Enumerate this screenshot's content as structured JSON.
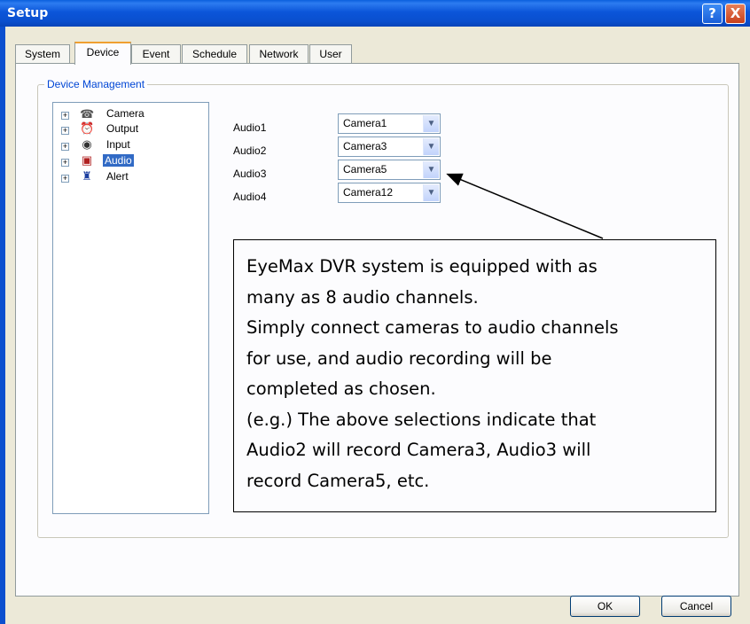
{
  "window": {
    "title": "Setup",
    "help_label": "?",
    "close_label": "X"
  },
  "tabs": [
    {
      "label": "System"
    },
    {
      "label": "Device",
      "active": true
    },
    {
      "label": "Event"
    },
    {
      "label": "Schedule"
    },
    {
      "label": "Network"
    },
    {
      "label": "User"
    }
  ],
  "group": {
    "label": "Device Management"
  },
  "tree": [
    {
      "label": "Camera",
      "icon": "camera-icon"
    },
    {
      "label": "Output",
      "icon": "alarm-clock-icon"
    },
    {
      "label": "Input",
      "icon": "eye-icon"
    },
    {
      "label": "Audio",
      "icon": "speaker-icon",
      "selected": true
    },
    {
      "label": "Alert",
      "icon": "alert-icon"
    }
  ],
  "audio": [
    {
      "label": "Audio1",
      "value": "Camera1"
    },
    {
      "label": "Audio2",
      "value": "Camera3"
    },
    {
      "label": "Audio3",
      "value": "Camera5"
    },
    {
      "label": "Audio4",
      "value": "Camera12"
    }
  ],
  "callout": {
    "lines": [
      "EyeMax DVR system is equipped with as",
      "many as 8 audio channels.",
      "Simply connect cameras to audio channels",
      "for use, and audio recording will be",
      "completed as chosen.",
      "(e.g.) The above selections indicate that",
      "Audio2 will record Camera3, Audio3 will",
      "record Camera5, etc."
    ]
  },
  "buttons": {
    "ok": "OK",
    "cancel": "Cancel"
  },
  "colors": {
    "titlebar": "#0a55d9",
    "accent_label": "#0046d5",
    "selection": "#316ac5",
    "active_tab": "#f0a030"
  }
}
